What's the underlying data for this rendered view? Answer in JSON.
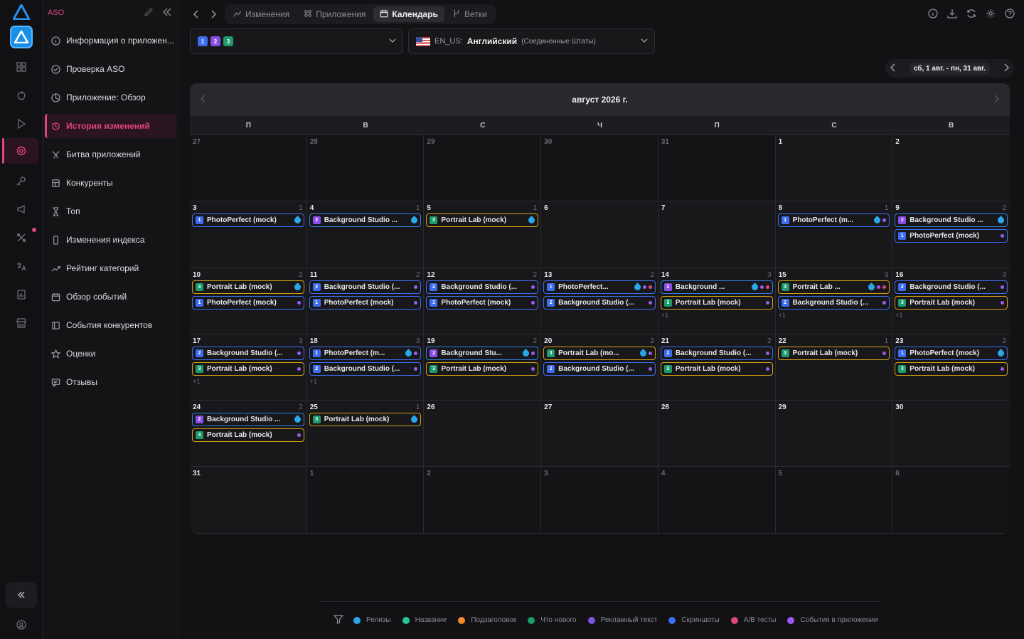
{
  "sidebar": {
    "brand": "ASO",
    "items": [
      {
        "label": "Информация о приложен...",
        "icon": "info-icon"
      },
      {
        "label": "Проверка ASO",
        "icon": "check-circle-icon"
      },
      {
        "label": "Приложение: Обзор",
        "icon": "pie-chart-icon"
      },
      {
        "label": "История изменений",
        "icon": "history-icon",
        "active": true
      },
      {
        "label": "Битва приложений",
        "icon": "swords-icon"
      },
      {
        "label": "Конкуренты",
        "icon": "competitors-icon"
      },
      {
        "label": "Топ",
        "icon": "hourglass-icon"
      },
      {
        "label": "Изменения индекса",
        "icon": "phone-icon"
      },
      {
        "label": "Рейтинг категорий",
        "icon": "trend-icon"
      },
      {
        "label": "Обзор событий",
        "icon": "calendar-icon"
      },
      {
        "label": "События конкурентов",
        "icon": "competitor-events-icon"
      },
      {
        "label": "Оценки",
        "icon": "star-icon"
      },
      {
        "label": "Отзывы",
        "icon": "reviews-icon"
      }
    ]
  },
  "topnav": {
    "tabs": [
      {
        "label": "Изменения",
        "icon": "chart-icon"
      },
      {
        "label": "Приложения",
        "icon": "apps-grid-icon"
      },
      {
        "label": "Календарь",
        "icon": "calendar-icon",
        "active": true
      },
      {
        "label": "Ветки",
        "icon": "branch-icon"
      }
    ]
  },
  "app_selector": {
    "badges": [
      "1",
      "2",
      "3"
    ]
  },
  "locale_selector": {
    "code": "EN_US:",
    "name": "Английский",
    "country": "(Соединенные Штаты)"
  },
  "date_range": {
    "label": "сб, 1 авг. - пн, 31 авг."
  },
  "calendar": {
    "title": "август 2026 г.",
    "weekdays": [
      "П",
      "В",
      "С",
      "Ч",
      "П",
      "С",
      "В"
    ],
    "colors": {
      "release": "#2aa7e8",
      "name": "#26c59a",
      "subtitle": "#f08a2a",
      "whats_new": "#1f9a6a",
      "promo": "#7a55e0",
      "screenshots": "#3d6df2",
      "ab": "#e0457b",
      "in_app": "#9a5cf0"
    },
    "weeks": [
      [
        {
          "d": "27",
          "muted": true,
          "count": "",
          "events": [],
          "more": ""
        },
        {
          "d": "28",
          "muted": true,
          "count": "",
          "events": [],
          "more": ""
        },
        {
          "d": "29",
          "muted": true,
          "count": "",
          "events": [],
          "more": ""
        },
        {
          "d": "30",
          "muted": true,
          "count": "",
          "events": [],
          "more": ""
        },
        {
          "d": "31",
          "muted": true,
          "count": "",
          "events": [],
          "more": ""
        },
        {
          "d": "1",
          "count": "",
          "events": [],
          "more": ""
        },
        {
          "d": "2",
          "count": "",
          "events": [],
          "more": ""
        }
      ],
      [
        {
          "d": "3",
          "count": "1",
          "events": [
            {
              "app": "1",
              "name": "PhotoPerfect (mock)",
              "marks": [
                "drop"
              ]
            }
          ],
          "more": ""
        },
        {
          "d": "4",
          "count": "1",
          "events": [
            {
              "app": "2",
              "name": "Background Studio ...",
              "marks": [
                "drop"
              ]
            }
          ],
          "more": ""
        },
        {
          "d": "5",
          "count": "1",
          "events": [
            {
              "app": "3",
              "name": "Portrait Lab (mock)",
              "marks": [
                "drop"
              ]
            }
          ],
          "more": ""
        },
        {
          "d": "6",
          "count": "",
          "events": [],
          "more": ""
        },
        {
          "d": "7",
          "count": "",
          "events": [],
          "more": ""
        },
        {
          "d": "8",
          "count": "1",
          "events": [
            {
              "app": "1",
              "name": "PhotoPerfect (m...",
              "marks": [
                "drop",
                "in_app"
              ]
            }
          ],
          "more": ""
        },
        {
          "d": "9",
          "count": "2",
          "events": [
            {
              "app": "2",
              "name": "Background Studio ...",
              "marks": [
                "drop"
              ]
            },
            {
              "app": "1",
              "name": "PhotoPerfect (mock)",
              "marks": [
                "in_app"
              ]
            }
          ],
          "more": ""
        }
      ],
      [
        {
          "d": "10",
          "count": "2",
          "events": [
            {
              "app": "3",
              "name": "Portrait Lab (mock)",
              "marks": [
                "drop"
              ]
            },
            {
              "app": "1",
              "name": "PhotoPerfect (mock)",
              "marks": [
                "in_app"
              ]
            }
          ],
          "more": ""
        },
        {
          "d": "11",
          "count": "2",
          "events": [
            {
              "app": "2",
              "name": "Background Studio (...",
              "marks": [
                "in_app"
              ]
            },
            {
              "app": "1",
              "name": "PhotoPerfect (mock)",
              "marks": [
                "in_app"
              ]
            }
          ],
          "more": ""
        },
        {
          "d": "12",
          "count": "2",
          "events": [
            {
              "app": "2",
              "name": "Background Studio (...",
              "marks": [
                "in_app"
              ]
            },
            {
              "app": "1",
              "name": "PhotoPerfect (mock)",
              "marks": [
                "in_app"
              ]
            }
          ],
          "more": ""
        },
        {
          "d": "13",
          "count": "2",
          "events": [
            {
              "app": "1",
              "name": "PhotoPerfect...",
              "marks": [
                "drop",
                "in_app",
                "ab"
              ]
            },
            {
              "app": "2",
              "name": "Background Studio (...",
              "marks": [
                "in_app"
              ]
            }
          ],
          "more": ""
        },
        {
          "d": "14",
          "count": "3",
          "events": [
            {
              "app": "2",
              "name": "Background ...",
              "marks": [
                "drop",
                "in_app",
                "ab"
              ]
            },
            {
              "app": "3",
              "name": "Portrait Lab (mock)",
              "marks": [
                "in_app"
              ]
            }
          ],
          "more": "+1"
        },
        {
          "d": "15",
          "count": "3",
          "events": [
            {
              "app": "3",
              "name": "Portrait Lab ...",
              "marks": [
                "drop",
                "in_app",
                "ab"
              ]
            },
            {
              "app": "2",
              "name": "Background Studio (...",
              "marks": [
                "in_app"
              ]
            }
          ],
          "more": "+1"
        },
        {
          "d": "16",
          "count": "3",
          "events": [
            {
              "app": "2",
              "name": "Background Studio (...",
              "marks": [
                "in_app"
              ]
            },
            {
              "app": "3",
              "name": "Portrait Lab (mock)",
              "marks": [
                "in_app"
              ]
            }
          ],
          "more": "+1"
        }
      ],
      [
        {
          "d": "17",
          "count": "3",
          "events": [
            {
              "app": "2",
              "name": "Background Studio (...",
              "marks": [
                "in_app"
              ]
            },
            {
              "app": "3",
              "name": "Portrait Lab (mock)",
              "marks": [
                "in_app"
              ]
            }
          ],
          "more": "+1"
        },
        {
          "d": "18",
          "count": "3",
          "events": [
            {
              "app": "1",
              "name": "PhotoPerfect (m...",
              "marks": [
                "drop",
                "in_app"
              ]
            },
            {
              "app": "2",
              "name": "Background Studio (...",
              "marks": [
                "in_app"
              ]
            }
          ],
          "more": "+1"
        },
        {
          "d": "19",
          "count": "2",
          "events": [
            {
              "app": "2",
              "name": "Background Stu...",
              "marks": [
                "drop",
                "in_app"
              ]
            },
            {
              "app": "3",
              "name": "Portrait Lab (mock)",
              "marks": [
                "in_app"
              ]
            }
          ],
          "more": ""
        },
        {
          "d": "20",
          "count": "2",
          "events": [
            {
              "app": "3",
              "name": "Portrait Lab (mo...",
              "marks": [
                "drop",
                "in_app"
              ]
            },
            {
              "app": "2",
              "name": "Background Studio (...",
              "marks": [
                "in_app"
              ]
            }
          ],
          "more": ""
        },
        {
          "d": "21",
          "count": "2",
          "events": [
            {
              "app": "2",
              "name": "Background Studio (...",
              "marks": [
                "in_app"
              ]
            },
            {
              "app": "3",
              "name": "Portrait Lab (mock)",
              "marks": [
                "in_app"
              ]
            }
          ],
          "more": ""
        },
        {
          "d": "22",
          "count": "1",
          "events": [
            {
              "app": "3",
              "name": "Portrait Lab (mock)",
              "marks": [
                "in_app"
              ]
            }
          ],
          "more": ""
        },
        {
          "d": "23",
          "count": "2",
          "events": [
            {
              "app": "1",
              "name": "PhotoPerfect (mock)",
              "marks": [
                "drop"
              ]
            },
            {
              "app": "3",
              "name": "Portrait Lab (mock)",
              "marks": [
                "in_app"
              ]
            }
          ],
          "more": ""
        }
      ],
      [
        {
          "d": "24",
          "count": "2",
          "events": [
            {
              "app": "2",
              "name": "Background Studio ...",
              "marks": [
                "drop"
              ]
            },
            {
              "app": "3",
              "name": "Portrait Lab (mock)",
              "marks": [
                "in_app"
              ]
            }
          ],
          "more": ""
        },
        {
          "d": "25",
          "count": "1",
          "events": [
            {
              "app": "3",
              "name": "Portrait Lab (mock)",
              "marks": [
                "drop"
              ]
            }
          ],
          "more": ""
        },
        {
          "d": "26",
          "count": "",
          "events": [],
          "more": ""
        },
        {
          "d": "27",
          "count": "",
          "events": [],
          "more": ""
        },
        {
          "d": "28",
          "count": "",
          "events": [],
          "more": ""
        },
        {
          "d": "29",
          "count": "",
          "events": [],
          "more": ""
        },
        {
          "d": "30",
          "count": "",
          "events": [],
          "more": ""
        }
      ],
      [
        {
          "d": "31",
          "count": "",
          "events": [],
          "more": ""
        },
        {
          "d": "1",
          "muted": true,
          "count": "",
          "events": [],
          "more": ""
        },
        {
          "d": "2",
          "muted": true,
          "count": "",
          "events": [],
          "more": ""
        },
        {
          "d": "3",
          "muted": true,
          "count": "",
          "events": [],
          "more": ""
        },
        {
          "d": "4",
          "muted": true,
          "count": "",
          "events": [],
          "more": ""
        },
        {
          "d": "5",
          "muted": true,
          "count": "",
          "events": [],
          "more": ""
        },
        {
          "d": "6",
          "muted": true,
          "count": "",
          "events": [],
          "more": ""
        }
      ]
    ]
  },
  "legend": [
    {
      "label": "Релизы",
      "color": "#2aa7e8"
    },
    {
      "label": "Название",
      "color": "#26c59a"
    },
    {
      "label": "Подзаголовок",
      "color": "#f08a2a"
    },
    {
      "label": "Что нового",
      "color": "#1f9a6a"
    },
    {
      "label": "Рекламный текст",
      "color": "#7a55e0"
    },
    {
      "label": "Скриншоты",
      "color": "#3d6df2"
    },
    {
      "label": "A/B тесты",
      "color": "#e0457b"
    },
    {
      "label": "События в приложении",
      "color": "#9a5cf0"
    }
  ]
}
